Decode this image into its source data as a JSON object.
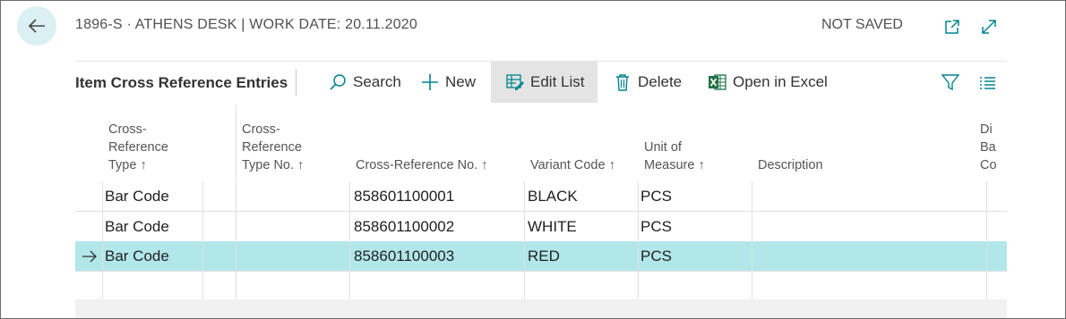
{
  "header": {
    "title": "1896-S · ATHENS DESK | WORK DATE: 20.11.2020",
    "status": "NOT SAVED",
    "icons": [
      "back-arrow-icon",
      "open-new-window-icon",
      "expand-icon"
    ]
  },
  "action_bar": {
    "page_caption": "Item Cross Reference Entries",
    "actions": {
      "search": "Search",
      "new": "New",
      "edit_list": "Edit List",
      "delete": "Delete",
      "open_in_excel": "Open in Excel"
    },
    "icons": [
      "search-icon",
      "plus-icon",
      "edit-list-icon",
      "trash-icon",
      "excel-icon",
      "filter-icon",
      "list-icon"
    ]
  },
  "columns": {
    "cross_reference_type": [
      "Cross-",
      "Reference",
      "Type ↑"
    ],
    "cross_reference_type_no": [
      "Cross-",
      "Reference",
      "Type No. ↑"
    ],
    "cross_reference_no": "Cross-Reference No. ↑",
    "variant_code": "Variant Code ↑",
    "unit_of_measure": [
      "Unit of",
      "Measure ↑"
    ],
    "description": "Description",
    "truncated": [
      "Di",
      "Ba",
      "Co"
    ]
  },
  "rows": [
    {
      "type": "Bar Code",
      "type_no": "",
      "ref_no": "858601100001",
      "variant": "BLACK",
      "uom": "PCS",
      "description": "",
      "selected": false
    },
    {
      "type": "Bar Code",
      "type_no": "",
      "ref_no": "858601100002",
      "variant": "WHITE",
      "uom": "PCS",
      "description": "",
      "selected": false
    },
    {
      "type": "Bar Code",
      "type_no": "",
      "ref_no": "858601100003",
      "variant": "RED",
      "uom": "PCS",
      "description": "",
      "selected": true
    }
  ],
  "selected_row_marker": "→",
  "colors": {
    "back_button_bg": "#daf0f2",
    "selected_row": "#b2e7ea",
    "accent": "#00838f",
    "excel_green": "#217346",
    "active_action_bg": "#e4e4e4"
  }
}
